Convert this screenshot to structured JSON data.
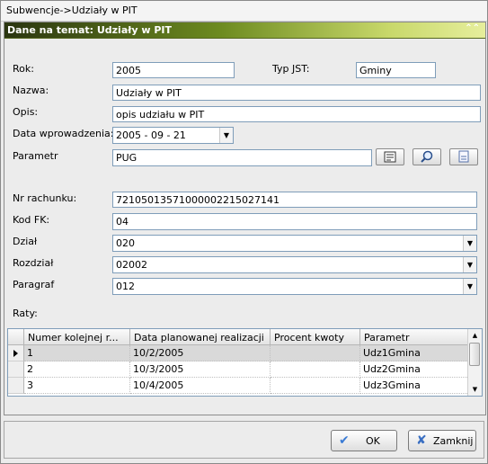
{
  "window": {
    "title": "Subwencje->Udziały w PIT"
  },
  "panel": {
    "title": "Dane na temat: Udziały w PIT",
    "collapse_glyph": "⌃⌃"
  },
  "form": {
    "rok_label": "Rok:",
    "rok_value": "2005",
    "typ_label": "Typ JST:",
    "typ_value": "Gminy",
    "nazwa_label": "Nazwa:",
    "nazwa_value": "Udziały w PIT",
    "opis_label": "Opis:",
    "opis_value": "opis udziału w PIT",
    "data_label": "Data wprowadzenia:",
    "data_value": "2005 - 09 - 21",
    "parametr_label": "Parametr",
    "parametr_value": "PUG",
    "nr_label": "Nr rachunku:",
    "nr_value": "72105013571000002215027141",
    "kodfk_label": "Kod FK:",
    "kodfk_value": "04",
    "dzial_label": "Dział",
    "dzial_value": "020",
    "rozdzial_label": "Rozdział",
    "rozdzial_value": "02002",
    "paragraf_label": "Paragraf",
    "paragraf_value": "012",
    "raty_label": "Raty:"
  },
  "grid": {
    "columns": [
      "Numer  kolejnej r...",
      "Data planowanej realizacji",
      "Procent kwoty",
      "Parametr"
    ],
    "rows": [
      [
        "1",
        "10/2/2005",
        "",
        "Udz1Gmina"
      ],
      [
        "2",
        "10/3/2005",
        "",
        "Udz2Gmina"
      ],
      [
        "3",
        "10/4/2005",
        "",
        "Udz3Gmina"
      ]
    ]
  },
  "buttons": {
    "ok": "OK",
    "close": "Zamknij"
  },
  "colors": {
    "header_dark": "#2a3510",
    "header_light": "#e6ee9c",
    "input_border": "#7f9db9"
  }
}
